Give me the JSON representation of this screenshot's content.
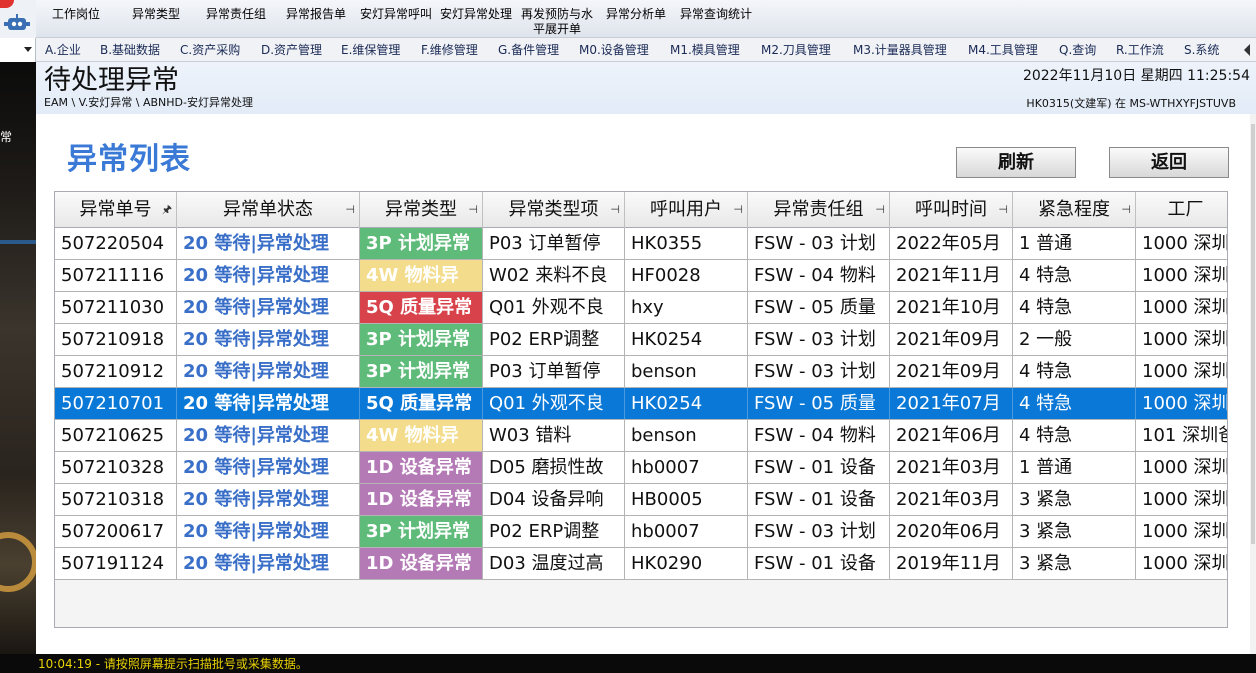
{
  "toolbar": {
    "items": [
      "工作岗位",
      "异常类型",
      "异常责任组",
      "异常报告单",
      "安灯异常呼叫",
      "安灯异常处理",
      "再发预防与水平展开单",
      "异常分析单",
      "异常查询统计"
    ]
  },
  "menu": {
    "items": [
      "A.企业",
      "B.基础数据",
      "C.资产采购",
      "D.资产管理",
      "E.维保管理",
      "F.维修管理",
      "G.备件管理",
      "M0.设备管理",
      "M1.模具管理",
      "M2.刀具管理",
      "M3.计量器具管理",
      "M4.工具管理",
      "Q.查询",
      "R.工作流",
      "S.系统"
    ]
  },
  "side": {
    "label": "常"
  },
  "header": {
    "title": "待处理异常",
    "breadcrumb": "EAM \\ V.安灯异常 \\ ABNHD-安灯异常处理",
    "datetime": "2022年11月10日 星期四 11:25:54",
    "user": "HK0315(文建军) 在 MS-WTHXYFJSTUVB"
  },
  "content": {
    "list_title": "异常列表",
    "refresh_label": "刷新",
    "back_label": "返回"
  },
  "table": {
    "columns": [
      "异常单号",
      "异常单状态",
      "异常类型",
      "异常类型项",
      "呼叫用户",
      "异常责任组",
      "呼叫时间",
      "紧急程度",
      "工厂"
    ],
    "rows": [
      [
        "507220504",
        "20 等待|异常处理",
        "3P 计划异常",
        "P03 订单暂停",
        "HK0355",
        "FSW - 03 计划",
        "2022年05月",
        "1 普通",
        "1000 深圳"
      ],
      [
        "507211116",
        "20 等待|异常处理",
        "4W 物料异",
        "W02 来料不良",
        "HF0028",
        "FSW - 04 物料",
        "2021年11月",
        "4 特急",
        "1000 深圳"
      ],
      [
        "507211030",
        "20 等待|异常处理",
        "5Q 质量异常",
        "Q01 外观不良",
        "hxy",
        "FSW - 05 质量",
        "2021年10月",
        "4 特急",
        "1000 深圳"
      ],
      [
        "507210918",
        "20 等待|异常处理",
        "3P 计划异常",
        "P02 ERP调整",
        "HK0254",
        "FSW - 03 计划",
        "2021年09月",
        "2 一般",
        "1000 深圳"
      ],
      [
        "507210912",
        "20 等待|异常处理",
        "3P 计划异常",
        "P03 订单暂停",
        "benson",
        "FSW - 03 计划",
        "2021年09月",
        "4 特急",
        "1000 深圳"
      ],
      [
        "507210701",
        "20 等待|异常处理",
        "5Q 质量异常",
        "Q01 外观不良",
        "HK0254",
        "FSW - 05 质量",
        "2021年07月",
        "4 特急",
        "1000 深圳"
      ],
      [
        "507210625",
        "20 等待|异常处理",
        "4W 物料异",
        "W03 错料",
        "benson",
        "FSW - 04 物料",
        "2021年06月",
        "4 特急",
        "101 深圳爸"
      ],
      [
        "507210328",
        "20 等待|异常处理",
        "1D 设备异常",
        "D05 磨损性故",
        "hb0007",
        "FSW - 01 设备",
        "2021年03月",
        "1 普通",
        "1000 深圳"
      ],
      [
        "507210318",
        "20 等待|异常处理",
        "1D 设备异常",
        "D04 设备异响",
        "HB0005",
        "FSW - 01 设备",
        "2021年03月",
        "3 紧急",
        "1000 深圳"
      ],
      [
        "507200617",
        "20 等待|异常处理",
        "3P 计划异常",
        "P02 ERP调整",
        "hb0007",
        "FSW - 03 计划",
        "2020年06月",
        "3 紧急",
        "1000 深圳"
      ],
      [
        "507191124",
        "20 等待|异常处理",
        "1D 设备异常",
        "D03 温度过高",
        "HK0290",
        "FSW - 01 设备",
        "2019年11月",
        "3 紧急",
        "1000 深圳"
      ]
    ],
    "row_types": [
      "plan",
      "material",
      "quality",
      "plan",
      "plan",
      "quality",
      "material",
      "device",
      "device",
      "plan",
      "device"
    ],
    "selected_row": 5,
    "type_colors": {
      "plan": "#5fbb7a",
      "material": "#f3dc8c",
      "quality": "#d8424a",
      "device": "#b47ab6"
    }
  },
  "status": {
    "message": "10:04:19 - 请按照屏幕提示扫描批号或采集数据。"
  }
}
